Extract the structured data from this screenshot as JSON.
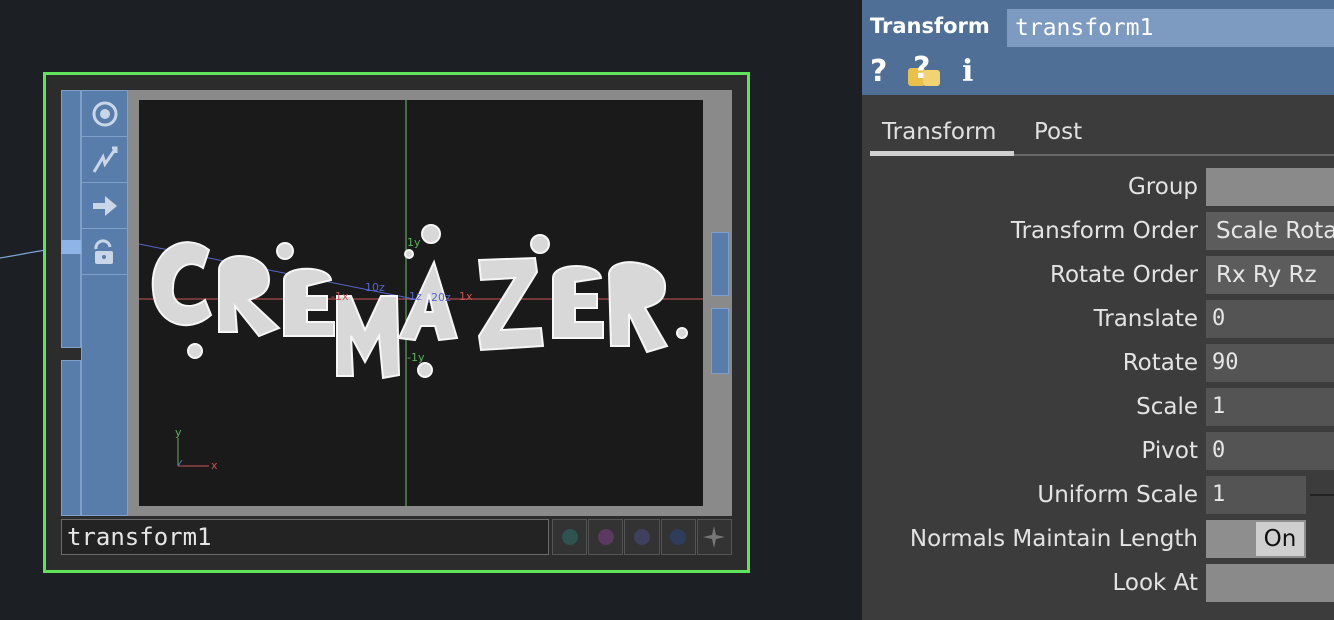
{
  "network": {
    "node": {
      "name": "transform1",
      "outline_color": "#5fe35a",
      "flag_icons": [
        "bypass-icon",
        "cook-icon",
        "display-icon",
        "lock-icon"
      ]
    },
    "viewer": {
      "axis_labels": {
        "y_pos": "1y",
        "y_neg": "-1y",
        "x_pos": "1x",
        "x_neg": "-1x",
        "z_pos": "10z",
        "z_neg": "20z",
        "center": "1z"
      },
      "gizmo": {
        "x": "x",
        "y": "y"
      },
      "bubble_text": "CREMAZER"
    },
    "node_buttons": [
      "viewer-active-icon",
      "clone-icon",
      "display-flag-icon",
      "render-flag-icon",
      "pin-icon"
    ]
  },
  "params": {
    "op_type": "Transform",
    "op_name": "transform1",
    "header_icons": [
      "help-icon",
      "python-help-icon",
      "info-icon"
    ],
    "tabs": [
      {
        "label": "Transform",
        "active": true
      },
      {
        "label": "Post",
        "active": false
      }
    ],
    "rows": {
      "group": {
        "label": "Group",
        "value": ""
      },
      "transform_order": {
        "label": "Transform Order",
        "value": "Scale Rotate Translate"
      },
      "rotate_order": {
        "label": "Rotate Order",
        "value": "Rx Ry Rz"
      },
      "translate": {
        "label": "Translate",
        "value": "0"
      },
      "rotate": {
        "label": "Rotate",
        "value": "90"
      },
      "scale": {
        "label": "Scale",
        "value": "1"
      },
      "pivot": {
        "label": "Pivot",
        "value": "0"
      },
      "uniform_scale": {
        "label": "Uniform Scale",
        "value": "1"
      },
      "normals_maintain": {
        "label": "Normals Maintain Length",
        "value": "On"
      },
      "look_at": {
        "label": "Look At",
        "value": ""
      }
    }
  }
}
